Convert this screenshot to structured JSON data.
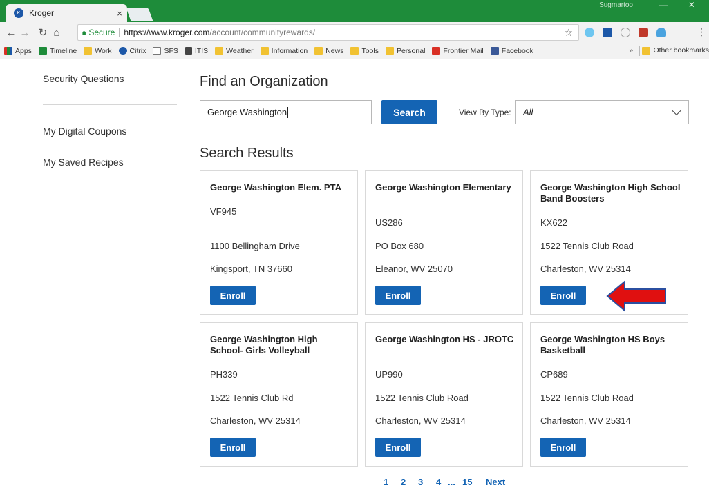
{
  "browser": {
    "tab_title": "Kroger",
    "tab_close": "×",
    "window_user": "Sugmartoo",
    "secure_label": "Secure",
    "url_host": "https://www.kroger.com",
    "url_path": "/account/communityrewards/",
    "bookmarks": [
      {
        "label": "Apps",
        "icon": "apps-grid-icon",
        "color": "#d93025"
      },
      {
        "label": "Timeline",
        "icon": "timeline-icon",
        "color": "#1e8c3a"
      },
      {
        "label": "Work",
        "icon": "folder-icon",
        "color": "#f1c232"
      },
      {
        "label": "Citrix",
        "icon": "citrix-icon",
        "color": "#1d58a8"
      },
      {
        "label": "SFS",
        "icon": "page-icon",
        "color": "#777777"
      },
      {
        "label": "ITIS",
        "icon": "itis-icon",
        "color": "#444444"
      },
      {
        "label": "Weather",
        "icon": "folder-icon",
        "color": "#f1c232"
      },
      {
        "label": "Information",
        "icon": "folder-icon",
        "color": "#f1c232"
      },
      {
        "label": "News",
        "icon": "folder-icon",
        "color": "#f1c232"
      },
      {
        "label": "Tools",
        "icon": "folder-icon",
        "color": "#f1c232"
      },
      {
        "label": "Personal",
        "icon": "folder-icon",
        "color": "#f1c232"
      },
      {
        "label": "Frontier Mail",
        "icon": "frontier-icon",
        "color": "#d93025"
      },
      {
        "label": "Facebook",
        "icon": "facebook-icon",
        "color": "#3b5998"
      }
    ],
    "bookmarks_more": "»",
    "other_bookmarks": "Other bookmarks"
  },
  "sidebar": {
    "security_questions": "Security Questions",
    "digital_coupons": "My Digital Coupons",
    "saved_recipes": "My Saved Recipes"
  },
  "main": {
    "heading": "Find an Organization",
    "search_value": "George Washington",
    "search_button": "Search",
    "view_by_label": "View By Type:",
    "view_by_value": "All",
    "results_heading": "Search Results",
    "enroll_label": "Enroll"
  },
  "results": [
    {
      "name": "George Washington Elem. PTA",
      "code": "VF945",
      "address": "1100 Bellingham Drive",
      "city": "Kingsport, TN 37660"
    },
    {
      "name": "George Washington Elementary",
      "code": "US286",
      "address": "PO Box 680",
      "city": "Eleanor, WV 25070"
    },
    {
      "name": "George Washington High School Band Boosters",
      "code": "KX622",
      "address": "1522 Tennis Club Road",
      "city": "Charleston, WV 25314"
    },
    {
      "name": "George Washington High School- Girls Volleyball",
      "code": "PH339",
      "address": "1522 Tennis Club Rd",
      "city": "Charleston, WV 25314"
    },
    {
      "name": "George Washington HS - JROTC",
      "code": "UP990",
      "address": "1522 Tennis Club Road",
      "city": "Charleston, WV 25314"
    },
    {
      "name": "George Washington HS Boys Basketball",
      "code": "CP689",
      "address": "1522 Tennis Club Road",
      "city": "Charleston, WV 25314"
    }
  ],
  "pagination": {
    "pages": [
      "1",
      "2",
      "3",
      "4"
    ],
    "ellipsis": "...",
    "last_page": "15",
    "next": "Next"
  },
  "colors": {
    "brand_blue": "#1464b4",
    "chrome_green": "#1e8c3a",
    "annotation_arrow": "#e01010"
  }
}
